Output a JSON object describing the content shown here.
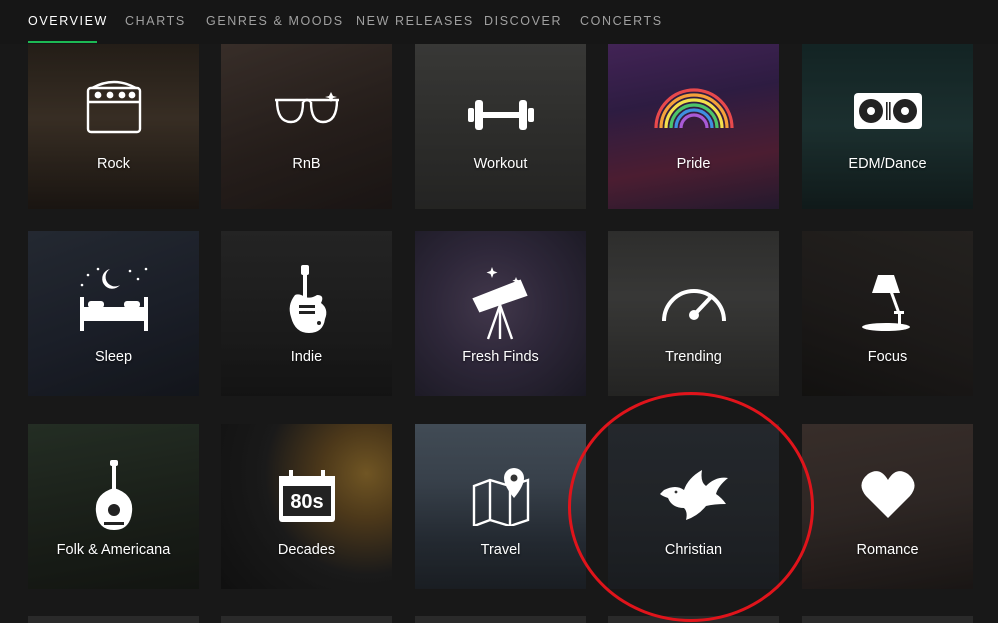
{
  "nav": {
    "tabs": [
      {
        "label": "OVERVIEW",
        "active": true
      },
      {
        "label": "CHARTS"
      },
      {
        "label": "GENRES & MOODS"
      },
      {
        "label": "NEW RELEASES"
      },
      {
        "label": "DISCOVER"
      },
      {
        "label": "CONCERTS"
      }
    ]
  },
  "categories": [
    {
      "label": "Rock",
      "icon": "amplifier-icon"
    },
    {
      "label": "RnB",
      "icon": "sunglasses-icon"
    },
    {
      "label": "Workout",
      "icon": "dumbbell-icon"
    },
    {
      "label": "Pride",
      "icon": "rainbow-icon"
    },
    {
      "label": "EDM/Dance",
      "icon": "turntable-icon"
    },
    {
      "label": "Sleep",
      "icon": "bed-moon-icon"
    },
    {
      "label": "Indie",
      "icon": "electric-guitar-icon"
    },
    {
      "label": "Fresh Finds",
      "icon": "telescope-icon"
    },
    {
      "label": "Trending",
      "icon": "gauge-icon"
    },
    {
      "label": "Focus",
      "icon": "desk-lamp-icon"
    },
    {
      "label": "Folk & Americana",
      "icon": "mandolin-icon"
    },
    {
      "label": "Decades",
      "icon": "calendar-80s-icon"
    },
    {
      "label": "Travel",
      "icon": "map-pin-icon"
    },
    {
      "label": "Christian",
      "icon": "dove-icon"
    },
    {
      "label": "Romance",
      "icon": "heart-icon"
    }
  ],
  "decades_icon_text": "80s",
  "colors": {
    "accent": "#1db954",
    "annotation": "#e0141b",
    "background": "#181818"
  }
}
